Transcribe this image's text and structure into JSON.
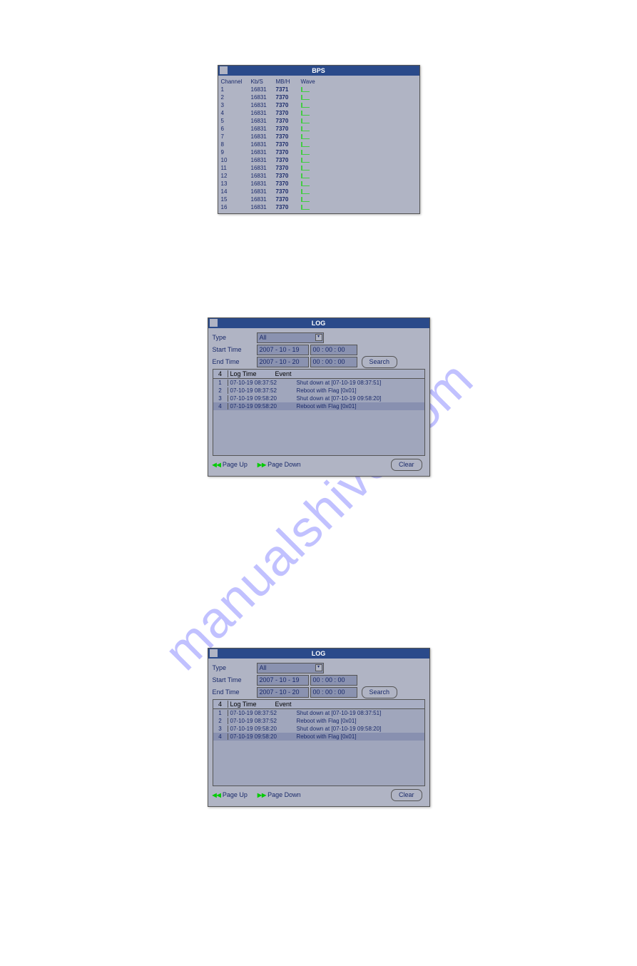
{
  "watermark": "manualshive.com",
  "bps": {
    "title": "BPS",
    "headers": {
      "channel": "Channel",
      "kbs": "Kb/S",
      "mbh": "MB/H",
      "wave": "Wave"
    },
    "rows": [
      {
        "ch": "1",
        "kbs": "16831",
        "mbh": "7371"
      },
      {
        "ch": "2",
        "kbs": "16831",
        "mbh": "7370"
      },
      {
        "ch": "3",
        "kbs": "16831",
        "mbh": "7370"
      },
      {
        "ch": "4",
        "kbs": "16831",
        "mbh": "7370"
      },
      {
        "ch": "5",
        "kbs": "16831",
        "mbh": "7370"
      },
      {
        "ch": "6",
        "kbs": "16831",
        "mbh": "7370"
      },
      {
        "ch": "7",
        "kbs": "16831",
        "mbh": "7370"
      },
      {
        "ch": "8",
        "kbs": "16831",
        "mbh": "7370"
      },
      {
        "ch": "9",
        "kbs": "16831",
        "mbh": "7370"
      },
      {
        "ch": "10",
        "kbs": "16831",
        "mbh": "7370"
      },
      {
        "ch": "11",
        "kbs": "16831",
        "mbh": "7370"
      },
      {
        "ch": "12",
        "kbs": "16831",
        "mbh": "7370"
      },
      {
        "ch": "13",
        "kbs": "16831",
        "mbh": "7370"
      },
      {
        "ch": "14",
        "kbs": "16831",
        "mbh": "7370"
      },
      {
        "ch": "15",
        "kbs": "16831",
        "mbh": "7370"
      },
      {
        "ch": "16",
        "kbs": "16831",
        "mbh": "7370"
      }
    ]
  },
  "log": {
    "title": "LOG",
    "labels": {
      "type": "Type",
      "start_time": "Start Time",
      "end_time": "End Time",
      "log_time": "Log Time",
      "event": "Event"
    },
    "type_value": "All",
    "start_date": "2007 - 10 - 19",
    "start_time": "00 : 00 : 00",
    "end_date": "2007 - 10 - 20",
    "end_time": "00 : 00 : 00",
    "search_label": "Search",
    "count": "4",
    "rows": [
      {
        "n": "1",
        "time": "07-10-19 08:37:52",
        "event": "Shut down at [07-10-19 08:37:51]"
      },
      {
        "n": "2",
        "time": "07-10-19 08:37:52",
        "event": "Reboot with Flag [0x01]"
      },
      {
        "n": "3",
        "time": "07-10-19 09:58:20",
        "event": "Shut down at [07-10-19 09:58:20]"
      },
      {
        "n": "4",
        "time": "07-10-19 09:58:20",
        "event": "Reboot with Flag [0x01]"
      }
    ],
    "page_up": "Page Up",
    "page_down": "Page Down",
    "clear": "Clear"
  }
}
